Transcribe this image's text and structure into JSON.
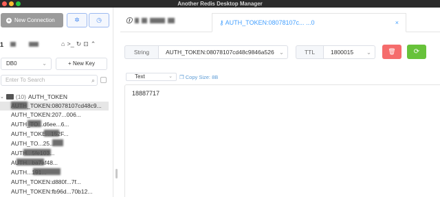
{
  "window": {
    "title": "Another Redis Desktop Manager",
    "traffic_lights": [
      "#ff5f57",
      "#febc2e",
      "#28c840"
    ]
  },
  "sidebar": {
    "new_connection_label": "New Connection",
    "db_select_value": "DB0",
    "new_key_label": "+ New Key",
    "filter_placeholder": "Enter To Search",
    "folder": {
      "count": "(10)",
      "name": "AUTH_TOKEN"
    },
    "keys": [
      "AUTH_TOKEN:08078107cd48c9...",
      "AUTH_TOKEN:207...006...",
      "AUTH_TO...d6ee...6...",
      "AUTH_TOKE...152F...",
      "AUTH_TO...25...",
      "AUTH...5fe103...",
      "AUTH...ba7af48...",
      "AUTH...191...",
      "AUTH_TOKEN:d880f...7f...",
      "AUTH_TOKEN:fb96d...70b12..."
    ]
  },
  "tabs": {
    "tab2_label": "AUTH_TOKEN:08078107c... ...0"
  },
  "key_detail": {
    "type_label": "String",
    "key_name": "AUTH_TOKEN:08078107cd48c9846a526",
    "ttl_label": "TTL",
    "ttl_value": "1800015",
    "format_value": "Text",
    "copy_size_label": "Copy Size: 8B",
    "value_text": "18887717"
  },
  "colors": {
    "accent": "#409eff",
    "delete": "#f56c6c",
    "refresh": "#67c23a",
    "titlebar": "#2b2b2b"
  }
}
